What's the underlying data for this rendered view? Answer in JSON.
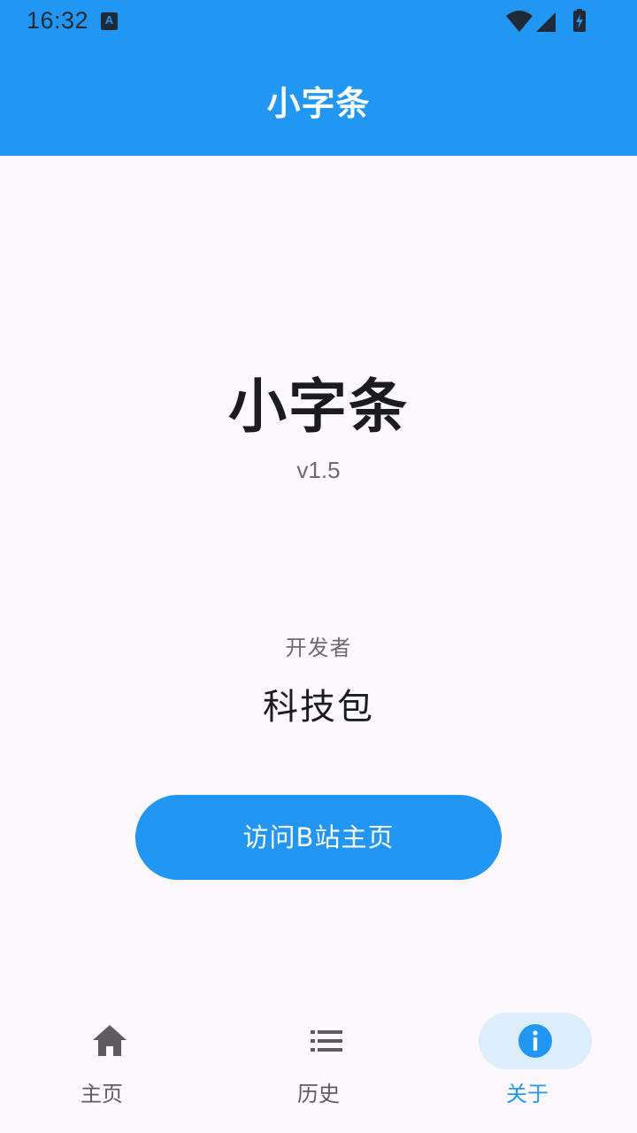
{
  "status_bar": {
    "time": "16:32",
    "notification_icon": "A"
  },
  "app_bar": {
    "title": "小字条"
  },
  "about": {
    "app_name": "小字条",
    "version": "v1.5",
    "developer_label": "开发者",
    "developer_name": "科技包",
    "visit_button_label": "访问B站主页"
  },
  "bottom_nav": {
    "items": [
      {
        "label": "主页",
        "icon": "home-icon",
        "active": false
      },
      {
        "label": "历史",
        "icon": "list-icon",
        "active": false
      },
      {
        "label": "关于",
        "icon": "info-icon",
        "active": true
      }
    ]
  },
  "colors": {
    "primary": "#2196f3",
    "background": "#fdf8fd",
    "active_indicator": "#dcedfb",
    "text_primary": "#1c1b1f",
    "text_secondary": "#6f6a70"
  }
}
